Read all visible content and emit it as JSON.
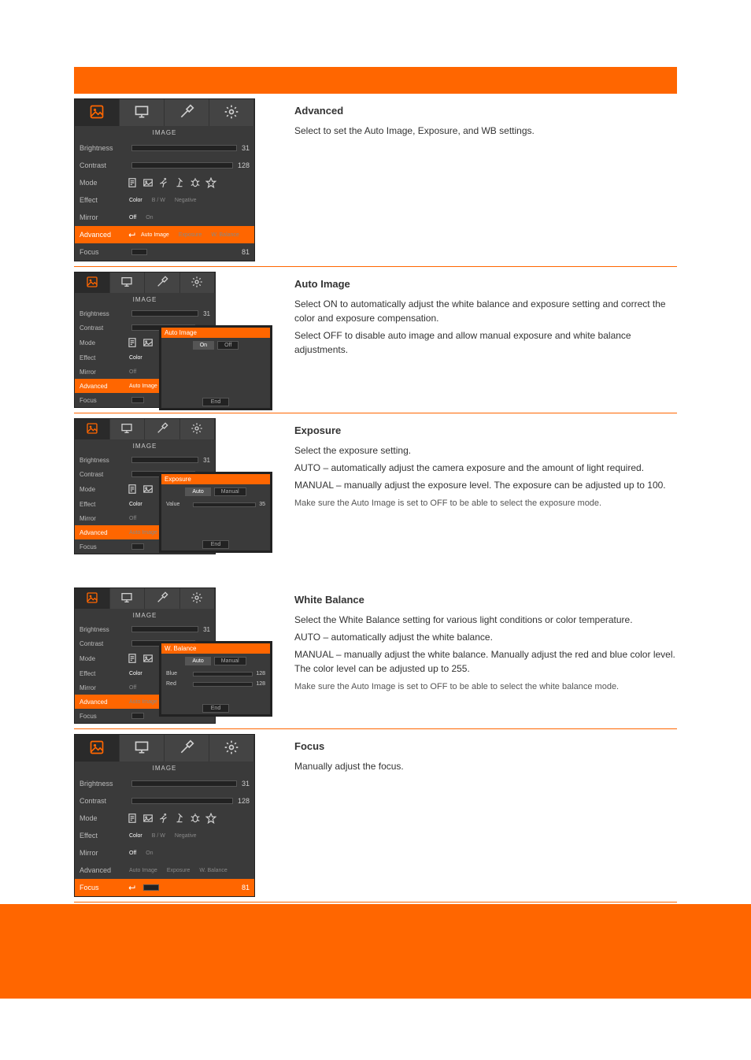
{
  "image_menu": {
    "title": "IMAGE",
    "rows": {
      "brightness": {
        "label": "Brightness",
        "value": "31"
      },
      "contrast": {
        "label": "Contrast",
        "value": "128"
      },
      "mode": {
        "label": "Mode"
      },
      "effect": {
        "label": "Effect",
        "opts": [
          "Color",
          "B / W",
          "Negative"
        ],
        "sel": "Color"
      },
      "mirror": {
        "label": "Mirror",
        "opts": [
          "Off",
          "On"
        ],
        "sel": "Off"
      },
      "advanced": {
        "label": "Advanced",
        "opts": [
          "Auto Image",
          "Exposure",
          "W. Balance"
        ]
      },
      "focus": {
        "label": "Focus",
        "value": "81"
      }
    }
  },
  "auto_image_popup": {
    "title": "Auto Image",
    "seg_on": "On",
    "seg_off": "Off",
    "btn": "End"
  },
  "exposure_popup": {
    "title": "Exposure",
    "seg_auto": "Auto",
    "seg_manual": "Manual",
    "value_label": "Value",
    "value": "35",
    "btn": "End"
  },
  "wb_popup": {
    "title": "W. Balance",
    "seg_auto": "Auto",
    "seg_manual": "Manual",
    "blue_label": "Blue",
    "blue_val": "128",
    "red_label": "Red",
    "red_val": "128",
    "btn": "End"
  },
  "desc": {
    "advanced": {
      "h": "Advanced",
      "p1": "Select to set the Auto Image, Exposure, and WB settings."
    },
    "auto_image": {
      "h": "Auto Image",
      "p1": "Select ON to automatically adjust the white balance and exposure setting and correct the color and exposure compensation.",
      "p2": "Select OFF to disable auto image and allow manual exposure and white balance adjustments."
    },
    "exposure": {
      "h": "Exposure",
      "p1": "Select the exposure setting.",
      "p2": "AUTO – automatically adjust the camera exposure and the amount of light required.",
      "p3": "MANUAL – manually adjust the exposure level. The exposure can be adjusted up to 100.",
      "note": "Make sure the Auto Image is set to OFF to be able to select the exposure mode."
    },
    "wb": {
      "h": "White Balance",
      "p1": "Select the White Balance setting for various light conditions or color temperature.",
      "p2": "AUTO – automatically adjust the white balance.",
      "p3": "MANUAL – manually adjust the white balance. Manually adjust the red and blue color level. The color level can be adjusted up to 255.",
      "note": "Make sure the Auto Image is set to OFF to be able to select the white balance mode."
    },
    "focus": {
      "h": "Focus",
      "p1": "Manually adjust the focus."
    }
  }
}
